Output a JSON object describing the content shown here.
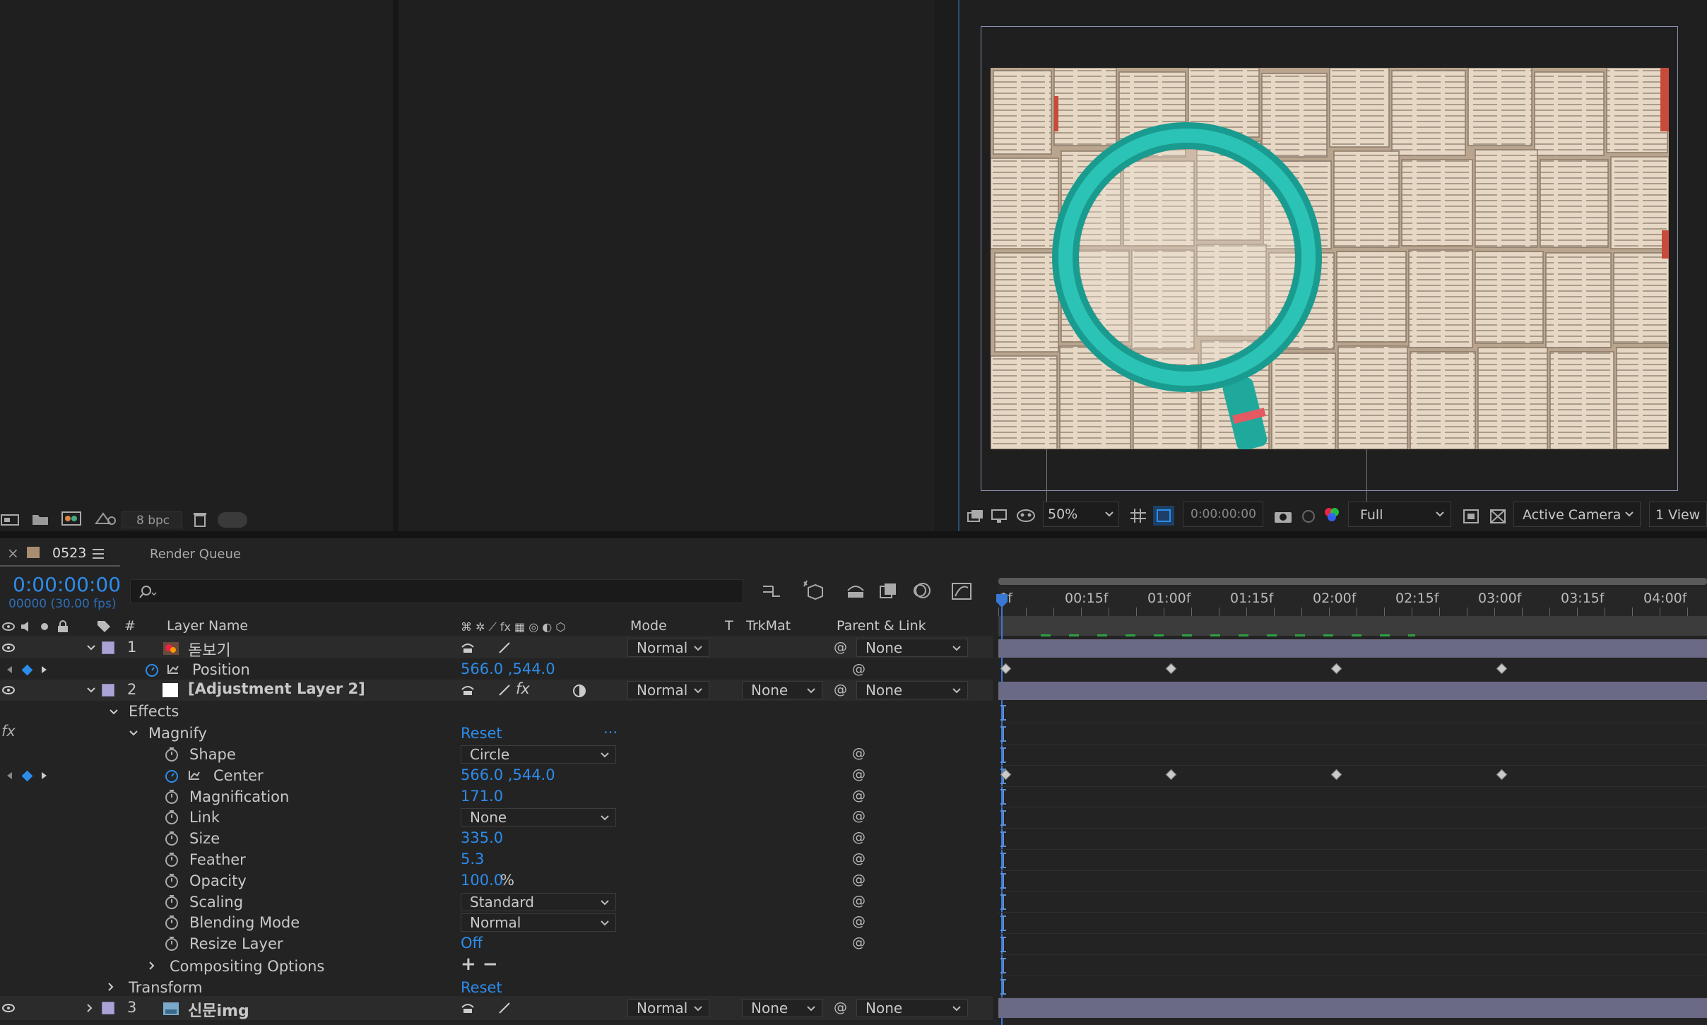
{
  "project_panel": {
    "bpc": "8 bpc"
  },
  "viewer": {
    "zoom": "50%",
    "timecode": "0:00:00:00",
    "resolution": "Full",
    "camera": "Active Camera",
    "views": "1 View"
  },
  "tabs": {
    "comp_name": "0523",
    "render_queue": "Render Queue",
    "close": "×"
  },
  "timeline": {
    "current_time": "0:00:00:00",
    "frame_info": "00000 (30.00 fps)",
    "ruler": [
      "0f",
      "00:15f",
      "01:00f",
      "01:15f",
      "02:00f",
      "02:15f",
      "03:00f",
      "03:15f",
      "04:00f"
    ],
    "columns": {
      "num": "#",
      "layer_name": "Layer Name",
      "mode": "Mode",
      "t": "T",
      "trkmat": "TrkMat",
      "parent": "Parent & Link"
    }
  },
  "layers": [
    {
      "num": "1",
      "name": "돋보기",
      "mode": "Normal",
      "parent": "None"
    },
    {
      "num": "2",
      "name": "[Adjustment Layer 2]",
      "mode": "Normal",
      "trkmat": "None",
      "parent": "None"
    },
    {
      "num": "3",
      "name": "신문img",
      "mode": "Normal",
      "trkmat": "None",
      "parent": "None"
    }
  ],
  "position": {
    "label": "Position",
    "value": "566.0 ,544.0"
  },
  "effects": {
    "effects_label": "Effects",
    "fx_label": "fx",
    "magnify": "Magnify",
    "reset": "Reset",
    "ellipsis": "...",
    "compositing": "Compositing Options",
    "plus_minus": "+ −",
    "transform": "Transform",
    "transform_reset": "Reset"
  },
  "properties": [
    {
      "label": "Shape",
      "value": "Circle",
      "kind": "select"
    },
    {
      "label": "Center",
      "value": "566.0 ,544.0",
      "kind": "value"
    },
    {
      "label": "Magnification",
      "value": "171.0",
      "kind": "value"
    },
    {
      "label": "Link",
      "value": "None",
      "kind": "select"
    },
    {
      "label": "Size",
      "value": "335.0",
      "kind": "value"
    },
    {
      "label": "Feather",
      "value": "5.3",
      "kind": "value"
    },
    {
      "label": "Opacity",
      "value": "100.0",
      "unit": "%",
      "kind": "value"
    },
    {
      "label": "Scaling",
      "value": "Standard",
      "kind": "select"
    },
    {
      "label": "Blending Mode",
      "value": "Normal",
      "kind": "select"
    },
    {
      "label": "Resize Layer",
      "value": "Off",
      "kind": "value"
    }
  ],
  "colors": {
    "accent": "#2d8ceb",
    "label_lavender": "#a9a3d6",
    "lens_teal": "#20b2a5",
    "layer_bar": "#6b6a86"
  }
}
